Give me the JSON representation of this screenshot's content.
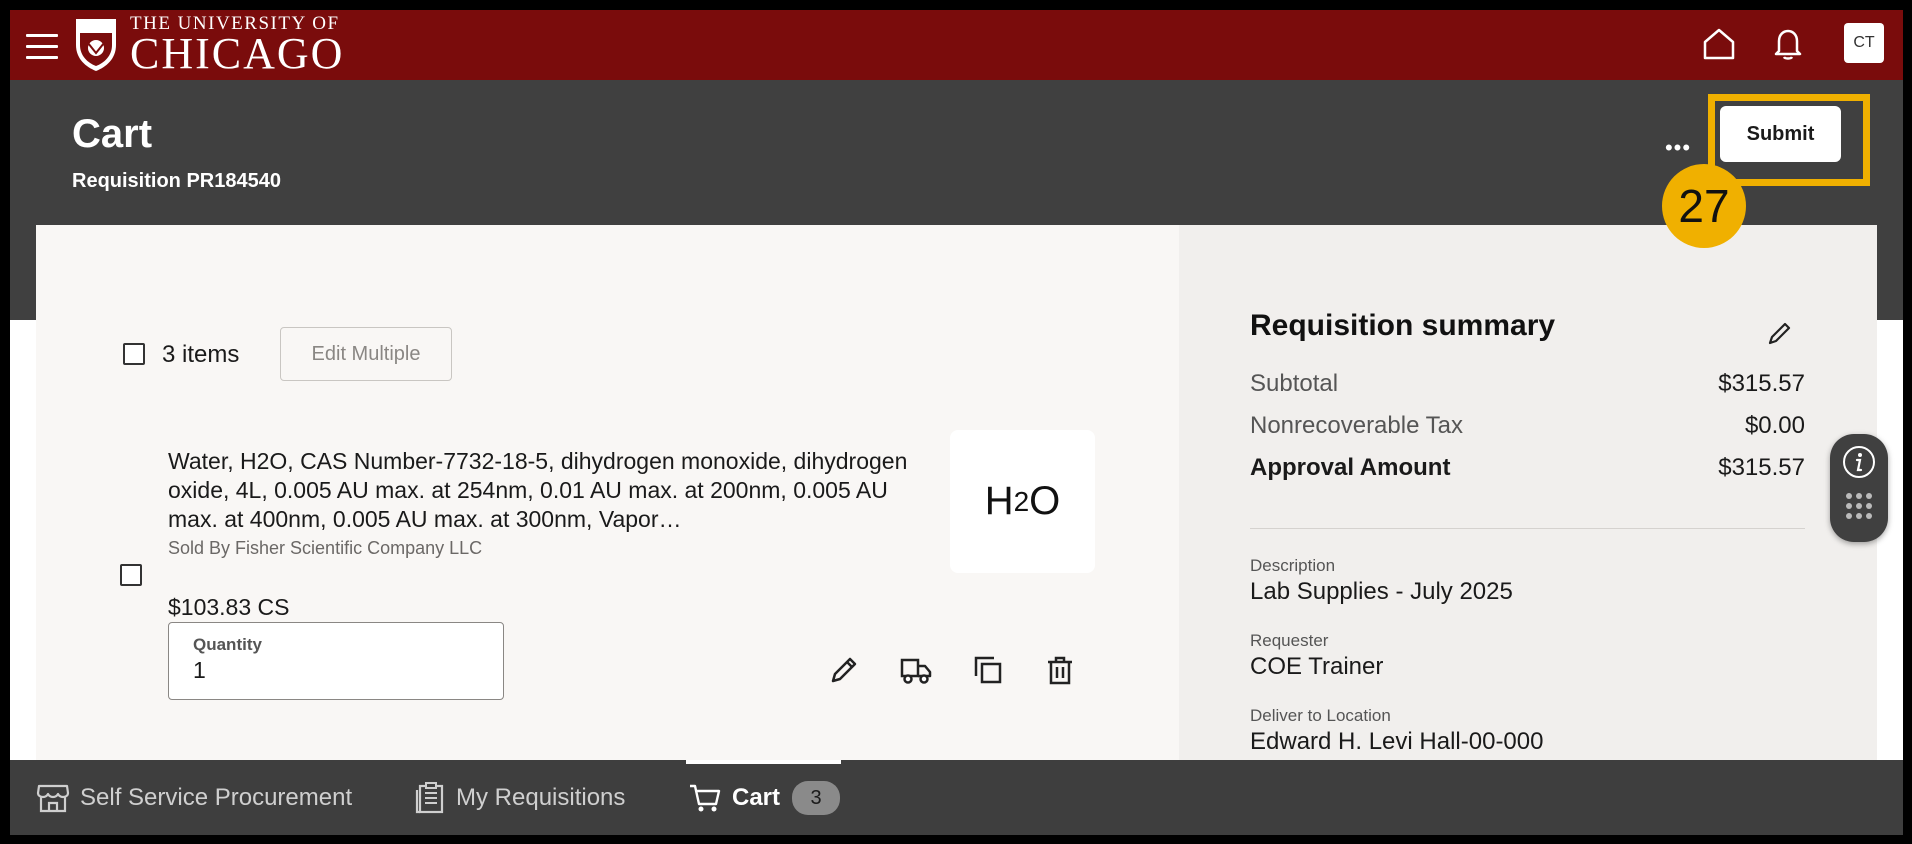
{
  "header": {
    "logo_line1": "THE UNIVERSITY OF",
    "logo_line2": "CHICAGO",
    "menu_icon": "hamburger-icon",
    "home_icon": "home-icon",
    "notifications_icon": "bell-icon",
    "avatar_initials": "CT"
  },
  "page": {
    "title": "Cart",
    "subtitle": "Requisition PR184540",
    "more_label": "•••",
    "submit_label": "Submit",
    "step_number": "27",
    "highlight_color": "#f0b000"
  },
  "cart": {
    "items_label": "3 items",
    "edit_multiple_label": "Edit Multiple",
    "item": {
      "description": "Water, H2O, CAS Number-7732-18-5, dihydrogen monoxide, dihydrogen oxide, 4L, 0.005 AU max. at 254nm, 0.01 AU max. at 200nm, 0.005 AU max. at 400nm, 0.005 AU max. at 300nm, Vapor…",
      "sold_by": "Sold By Fisher Scientific Company LLC",
      "price": "$103.83 CS",
      "quantity_label": "Quantity",
      "quantity_value": "1",
      "thumbnail_main": "H",
      "thumbnail_sub": "2",
      "thumbnail_end": "O",
      "actions": [
        "pencil-icon",
        "truck-icon",
        "copy-icon",
        "trash-icon"
      ]
    }
  },
  "summary": {
    "title": "Requisition summary",
    "edit_icon": "pencil-icon",
    "subtotal_label": "Subtotal",
    "subtotal_value": "$315.57",
    "tax_label": "Nonrecoverable Tax",
    "tax_value": "$0.00",
    "approval_label": "Approval Amount",
    "approval_value": "$315.57",
    "description_label": "Description",
    "description_value": "Lab Supplies - July 2025",
    "requester_label": "Requester",
    "requester_value": "COE Trainer",
    "deliver_label": "Deliver to Location",
    "deliver_value": "Edward H. Levi Hall-00-000"
  },
  "bottom_nav": {
    "items": [
      {
        "label": "Self Service Procurement",
        "icon": "store-icon"
      },
      {
        "label": "My Requisitions",
        "icon": "clipboard-icon"
      },
      {
        "label": "Cart",
        "icon": "cart-icon",
        "count": "3"
      }
    ]
  }
}
